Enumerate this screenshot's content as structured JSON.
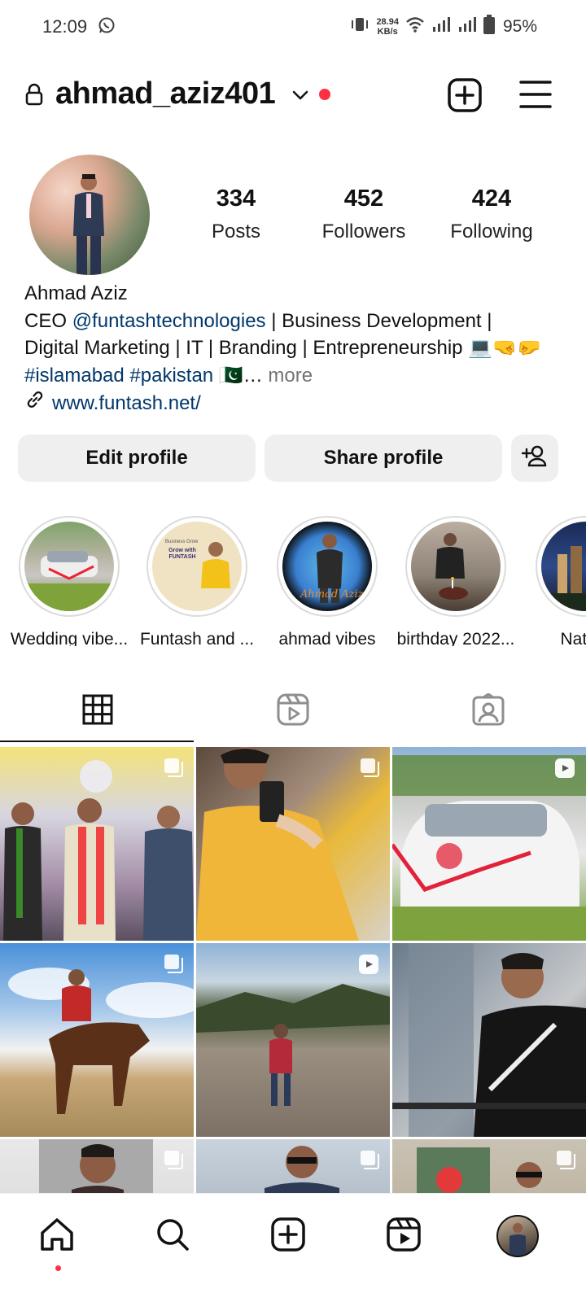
{
  "status_bar": {
    "time": "12:09",
    "speed_value": "28.94",
    "speed_unit": "KB/s",
    "battery": "95%"
  },
  "header": {
    "username": "ahmad_aziz401"
  },
  "profile": {
    "stats": [
      {
        "value": "334",
        "label": "Posts"
      },
      {
        "value": "452",
        "label": "Followers"
      },
      {
        "value": "424",
        "label": "Following"
      }
    ],
    "name": "Ahmad Aziz",
    "bio_line1_prefix": "CEO ",
    "bio_mention": "@funtashtechnologies",
    "bio_line1_suffix": " | Business Development |",
    "bio_line2": "Digital Marketing | IT | Branding | Entrepreneurship 💻🤜🤛",
    "bio_hashtags": "#islamabad #pakistan",
    "bio_flag": "🇵🇰…",
    "more": " more",
    "website": "www.funtash.net/"
  },
  "buttons": {
    "edit_profile": "Edit profile",
    "share_profile": "Share profile"
  },
  "highlights": [
    {
      "label": "Wedding vibe..."
    },
    {
      "label": "Funtash and ..."
    },
    {
      "label": "ahmad vibes"
    },
    {
      "label": "birthday 2022..."
    },
    {
      "label": "Nature"
    }
  ],
  "highlight_text": {
    "funtash_small": "Business Grow",
    "funtash_title": "Grow with FUNTASH",
    "funtash_brand": "FUNTASH",
    "ahmad_signature": "Ahmad Aziz"
  },
  "colors": {
    "accent_blue": "#00376b",
    "notification_red": "#ff3040",
    "button_gray": "#efefef"
  },
  "icons": {
    "status": [
      "whatsapp-icon",
      "vibrate-icon",
      "wifi-icon",
      "signal-icon",
      "battery-icon"
    ],
    "header": [
      "lock-icon",
      "chevron-down-icon",
      "create-icon",
      "menu-icon"
    ],
    "tabs": [
      "grid-icon",
      "reels-icon",
      "tagged-icon"
    ],
    "nav": [
      "home-icon",
      "search-icon",
      "create-icon",
      "reels-icon",
      "profile-avatar"
    ]
  }
}
